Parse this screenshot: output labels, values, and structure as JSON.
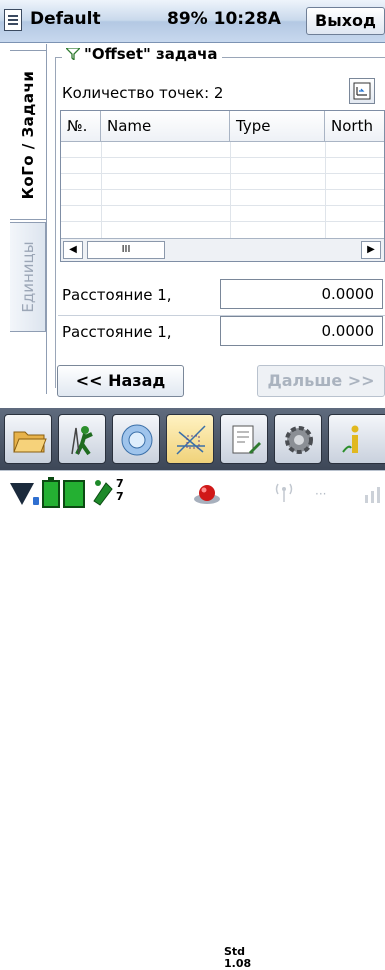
{
  "titlebar": {
    "app_title": "Default",
    "status": "89% 10:28A",
    "exit_label": "Выход"
  },
  "tabs": [
    {
      "label": "КоГо / Задачи"
    },
    {
      "label": "Единицы"
    }
  ],
  "group": {
    "title": "\"Offset\" задача",
    "points_count": "Количество точек: 2"
  },
  "table": {
    "columns": [
      "№.",
      "Name",
      "Type",
      "North"
    ],
    "rows": [],
    "scroll_thumb": "III"
  },
  "fields": [
    {
      "label": "Расстояние 1,",
      "value": "0.0000"
    },
    {
      "label": "Расстояние 1,",
      "value": "0.0000"
    }
  ],
  "nav": {
    "back_label": "<< Назад",
    "next_label": "Дальше >>"
  },
  "toolbar_icons": [
    "folder-icon",
    "survey-icon",
    "map-view-icon",
    "cogo-icon",
    "notes-icon",
    "settings-icon",
    "help-icon"
  ],
  "statusbar": {
    "icons": [
      "device-icon",
      "battery-icon",
      "satellite-icon",
      "record-led-icon",
      "radio-icon"
    ],
    "sat_a": "7",
    "sat_b": "7",
    "std_line1": "Std",
    "std_line2": "1.08",
    "colors": {
      "titlebar": "#c9d9ec",
      "toolbar": "#4a5567",
      "led": "#d01818",
      "battery": "#1aa32a"
    }
  }
}
